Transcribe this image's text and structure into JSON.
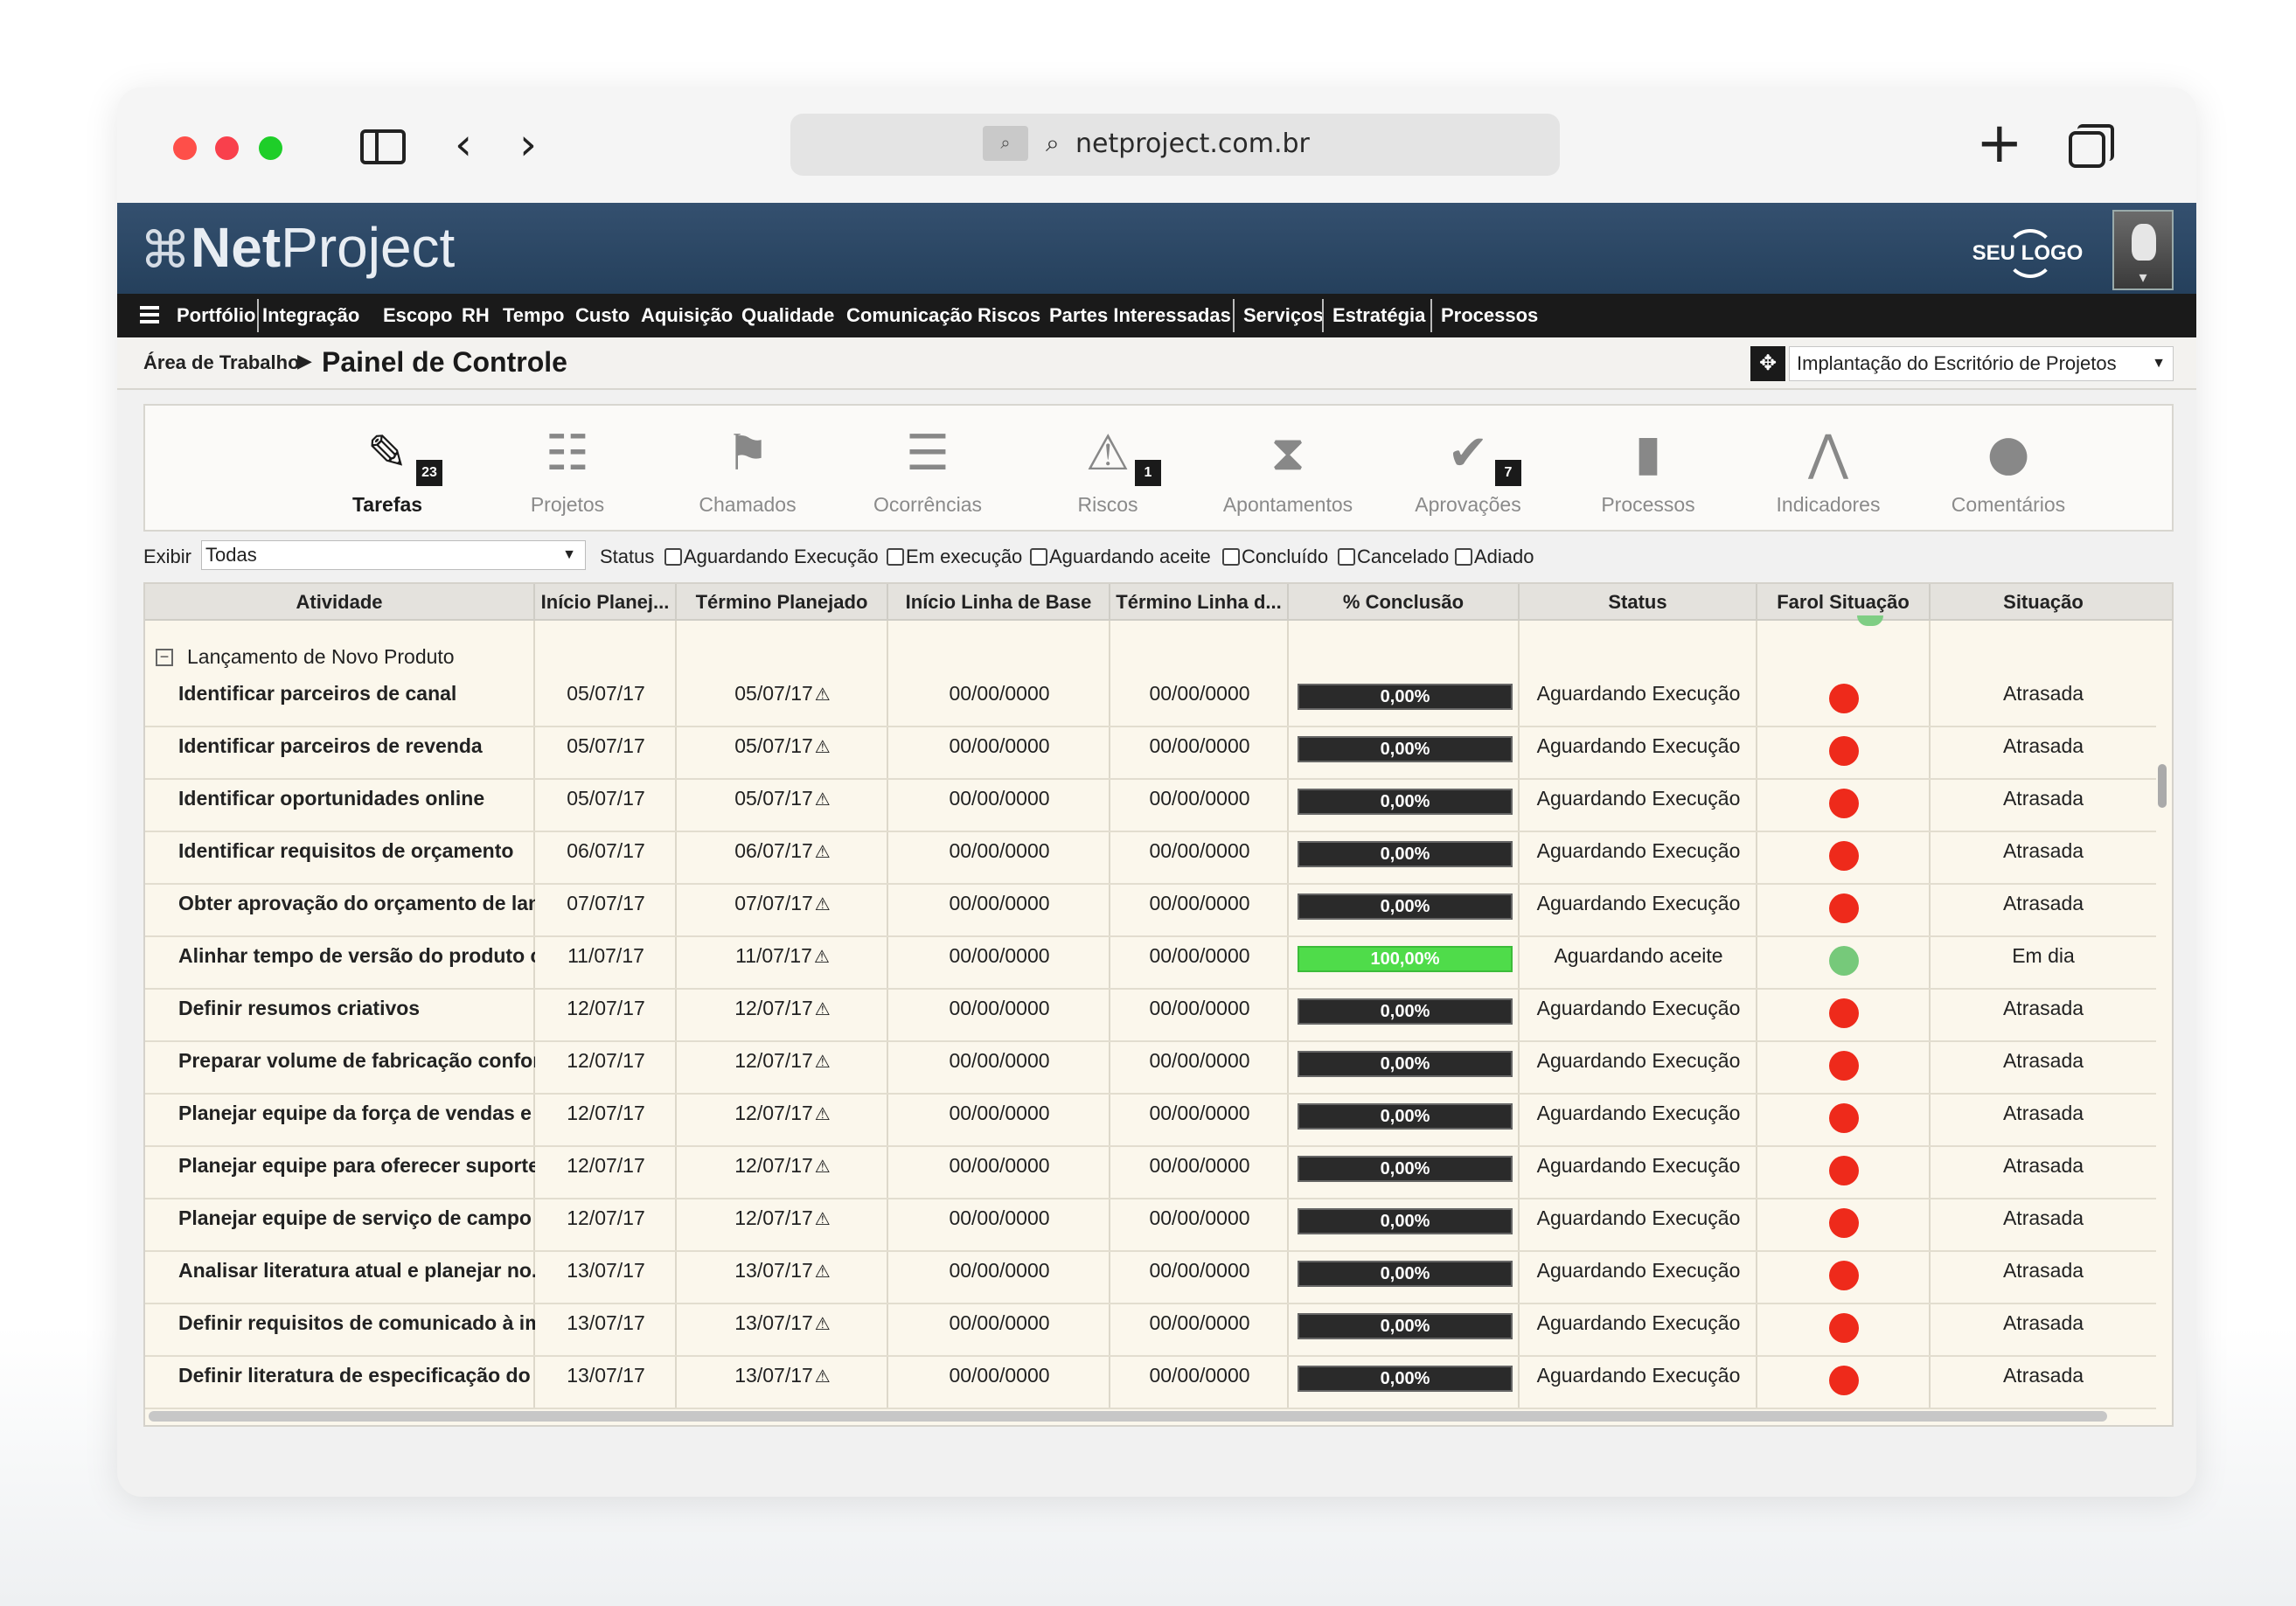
{
  "browser": {
    "url": "netproject.com.br"
  },
  "app": {
    "logo_net": "Net",
    "logo_project": "Project",
    "brand_logo": "SEU LOGO"
  },
  "menu": [
    "Portfólio",
    "Integração",
    "Escopo",
    "RH",
    "Tempo",
    "Custo",
    "Aquisição",
    "Qualidade",
    "Comunicação",
    "Riscos",
    "Partes Interessadas",
    "Serviços",
    "Estratégia",
    "Processos"
  ],
  "breadcrumb": {
    "home": "Área de Trabalho",
    "title": "Painel de Controle",
    "project": "Implantação do Escritório de Projetos"
  },
  "toolbar": [
    {
      "label": "Tarefas",
      "icon": "pencil-icon",
      "badge": "23"
    },
    {
      "label": "Projetos",
      "icon": "gantt-icon",
      "badge": ""
    },
    {
      "label": "Chamados",
      "icon": "flag-icon",
      "badge": ""
    },
    {
      "label": "Ocorrências",
      "icon": "list-icon",
      "badge": ""
    },
    {
      "label": "Riscos",
      "icon": "warning-icon",
      "badge": "1"
    },
    {
      "label": "Apontamentos",
      "icon": "hourglass-icon",
      "badge": ""
    },
    {
      "label": "Aprovações",
      "icon": "check-icon",
      "badge": "7"
    },
    {
      "label": "Processos",
      "icon": "document-icon",
      "badge": ""
    },
    {
      "label": "Indicadores",
      "icon": "indicators-icon",
      "badge": ""
    },
    {
      "label": "Comentários",
      "icon": "comment-icon",
      "badge": ""
    }
  ],
  "filters": {
    "exibir_label": "Exibir",
    "exibir_value": "Todas",
    "status_label": "Status",
    "status_options": [
      "Aguardando Execução",
      "Em execução",
      "Aguardando aceite",
      "Concluído",
      "Cancelado",
      "Adiado"
    ]
  },
  "table": {
    "columns": [
      "Atividade",
      "Início Planej...",
      "Término Planejado",
      "Início Linha de Base",
      "Término Linha d...",
      "% Conclusão",
      "Status",
      "Farol Situação",
      "Situação"
    ],
    "group": "Lançamento de Novo Produto",
    "rows": [
      {
        "atividade": "Identificar parceiros de canal",
        "inicio": "05/07/17",
        "termino": "05/07/17",
        "ini_base": "00/00/0000",
        "ter_base": "00/00/0000",
        "conclusao": "0,00%",
        "pct": 0,
        "status": "Aguardando Execução",
        "farol": "#ee2a1b",
        "situacao": "Atrasada"
      },
      {
        "atividade": "Identificar parceiros de revenda",
        "inicio": "05/07/17",
        "termino": "05/07/17",
        "ini_base": "00/00/0000",
        "ter_base": "00/00/0000",
        "conclusao": "0,00%",
        "pct": 0,
        "status": "Aguardando Execução",
        "farol": "#ee2a1b",
        "situacao": "Atrasada"
      },
      {
        "atividade": "Identificar oportunidades online",
        "inicio": "05/07/17",
        "termino": "05/07/17",
        "ini_base": "00/00/0000",
        "ter_base": "00/00/0000",
        "conclusao": "0,00%",
        "pct": 0,
        "status": "Aguardando Execução",
        "farol": "#ee2a1b",
        "situacao": "Atrasada"
      },
      {
        "atividade": "Identificar requisitos de orçamento",
        "inicio": "06/07/17",
        "termino": "06/07/17",
        "ini_base": "00/00/0000",
        "ter_base": "00/00/0000",
        "conclusao": "0,00%",
        "pct": 0,
        "status": "Aguardando Execução",
        "farol": "#ee2a1b",
        "situacao": "Atrasada"
      },
      {
        "atividade": "Obter aprovação do orçamento de lan...",
        "inicio": "07/07/17",
        "termino": "07/07/17",
        "ini_base": "00/00/0000",
        "ter_base": "00/00/0000",
        "conclusao": "0,00%",
        "pct": 0,
        "status": "Aguardando Execução",
        "farol": "#ee2a1b",
        "situacao": "Atrasada"
      },
      {
        "atividade": "Alinhar tempo de versão do produto c...",
        "inicio": "11/07/17",
        "termino": "11/07/17",
        "ini_base": "00/00/0000",
        "ter_base": "00/00/0000",
        "conclusao": "100,00%",
        "pct": 100,
        "status": "Aguardando aceite",
        "farol": "#76c97a",
        "situacao": "Em dia"
      },
      {
        "atividade": "Definir resumos criativos",
        "inicio": "12/07/17",
        "termino": "12/07/17",
        "ini_base": "00/00/0000",
        "ter_base": "00/00/0000",
        "conclusao": "0,00%",
        "pct": 0,
        "status": "Aguardando Execução",
        "farol": "#ee2a1b",
        "situacao": "Atrasada"
      },
      {
        "atividade": "Preparar volume de fabricação confor...",
        "inicio": "12/07/17",
        "termino": "12/07/17",
        "ini_base": "00/00/0000",
        "ter_base": "00/00/0000",
        "conclusao": "0,00%",
        "pct": 0,
        "status": "Aguardando Execução",
        "farol": "#ee2a1b",
        "situacao": "Atrasada"
      },
      {
        "atividade": "Planejar equipe da força de vendas e ...",
        "inicio": "12/07/17",
        "termino": "12/07/17",
        "ini_base": "00/00/0000",
        "ter_base": "00/00/0000",
        "conclusao": "0,00%",
        "pct": 0,
        "status": "Aguardando Execução",
        "farol": "#ee2a1b",
        "situacao": "Atrasada"
      },
      {
        "atividade": "Planejar equipe para oferecer suporte...",
        "inicio": "12/07/17",
        "termino": "12/07/17",
        "ini_base": "00/00/0000",
        "ter_base": "00/00/0000",
        "conclusao": "0,00%",
        "pct": 0,
        "status": "Aguardando Execução",
        "farol": "#ee2a1b",
        "situacao": "Atrasada"
      },
      {
        "atividade": "Planejar equipe de serviço de campo ...",
        "inicio": "12/07/17",
        "termino": "12/07/17",
        "ini_base": "00/00/0000",
        "ter_base": "00/00/0000",
        "conclusao": "0,00%",
        "pct": 0,
        "status": "Aguardando Execução",
        "farol": "#ee2a1b",
        "situacao": "Atrasada"
      },
      {
        "atividade": "Analisar literatura atual e planejar no...",
        "inicio": "13/07/17",
        "termino": "13/07/17",
        "ini_base": "00/00/0000",
        "ter_base": "00/00/0000",
        "conclusao": "0,00%",
        "pct": 0,
        "status": "Aguardando Execução",
        "farol": "#ee2a1b",
        "situacao": "Atrasada"
      },
      {
        "atividade": "Definir requisitos de comunicado à im...",
        "inicio": "13/07/17",
        "termino": "13/07/17",
        "ini_base": "00/00/0000",
        "ter_base": "00/00/0000",
        "conclusao": "0,00%",
        "pct": 0,
        "status": "Aguardando Execução",
        "farol": "#ee2a1b",
        "situacao": "Atrasada"
      },
      {
        "atividade": "Definir literatura de especificação do ...",
        "inicio": "13/07/17",
        "termino": "13/07/17",
        "ini_base": "00/00/0000",
        "ter_base": "00/00/0000",
        "conclusao": "0,00%",
        "pct": 0,
        "status": "Aguardando Execução",
        "farol": "#ee2a1b",
        "situacao": "Atrasada"
      }
    ]
  }
}
